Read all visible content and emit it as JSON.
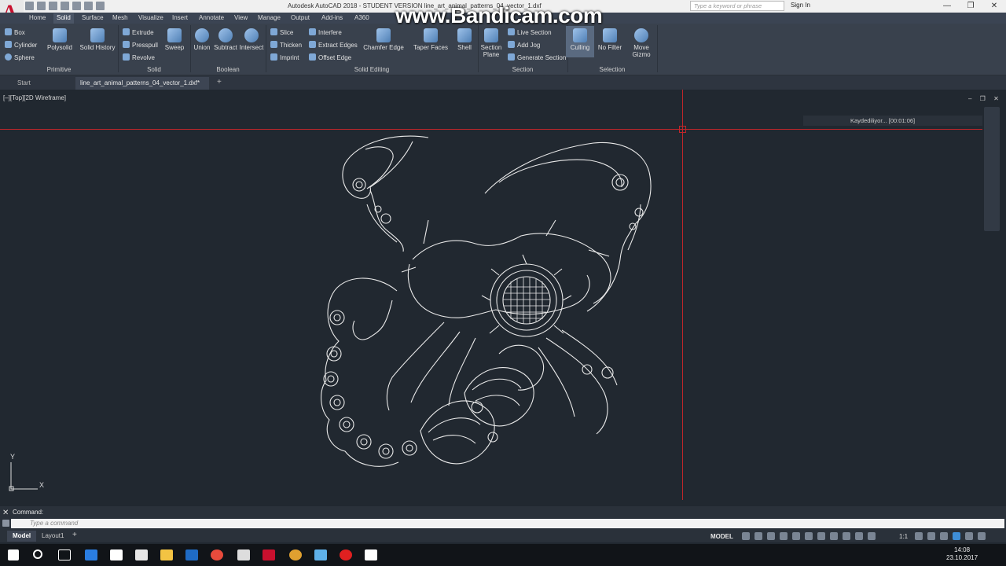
{
  "titlebar": {
    "title": "Autodesk AutoCAD 2018 - STUDENT VERSION    line_art_animal_patterns_04_vector_1.dxf",
    "search_placeholder": "Type a keyword or phrase",
    "signin": "Sign In",
    "min": "—",
    "max": "❐",
    "close": "✕"
  },
  "watermark": "www.Bandicam.com",
  "ribbon_tabs": [
    "Home",
    "Solid",
    "Surface",
    "Mesh",
    "Visualize",
    "Insert",
    "Annotate",
    "View",
    "Manage",
    "Output",
    "Add-ins",
    "A360"
  ],
  "ribbon": {
    "primitive": {
      "title": "Primitive",
      "box": "Box",
      "cylinder": "Cylinder",
      "sphere": "Sphere",
      "polysolid": "Polysolid"
    },
    "solid": {
      "title": "Solid",
      "history": "Solid History",
      "extrude": "Extrude",
      "presspull": "Presspull",
      "revolve": "Revolve",
      "sweep": "Sweep"
    },
    "boolean": {
      "title": "Boolean",
      "union": "Union",
      "subtract": "Subtract",
      "intersect": "Intersect"
    },
    "solid_editing": {
      "title": "Solid Editing",
      "slice": "Slice",
      "thicken": "Thicken",
      "imprint": "Imprint",
      "interfere": "Interfere",
      "extract_edges": "Extract Edges",
      "offset_edge": "Offset Edge",
      "chamfer_edge": "Chamfer Edge",
      "taper_faces": "Taper Faces",
      "shell": "Shell"
    },
    "section": {
      "title": "Section",
      "section_plane": "Section Plane",
      "live_section": "Live Section",
      "add_jog": "Add Jog",
      "generate_section": "Generate Section"
    },
    "selection": {
      "title": "Selection",
      "culling": "Culling",
      "no_filter": "No Filter",
      "move_gizmo": "Move Gizmo"
    }
  },
  "file_tabs": {
    "start": "Start",
    "drawing": "line_art_animal_patterns_04_vector_1.dxf*"
  },
  "viewport": {
    "label": "[–][Top][2D Wireframe]",
    "controls": "– ❐ ✕"
  },
  "recording": {
    "text": "Kaydediliyor... [00:01:06]"
  },
  "ucs": {
    "x": "X",
    "y": "Y"
  },
  "command": {
    "history": "Command:",
    "placeholder": "Type a command",
    "close": "✕"
  },
  "layout_tabs": [
    "Model",
    "Layout1"
  ],
  "status": {
    "model": "MODEL",
    "scale": "1:1"
  },
  "clock": {
    "time": "14:08",
    "date": "23.10.2017"
  },
  "colors": {
    "background": "#212830",
    "crosshair": "#c0262a",
    "ribbon": "#39414d",
    "accent": "#c8102e"
  }
}
